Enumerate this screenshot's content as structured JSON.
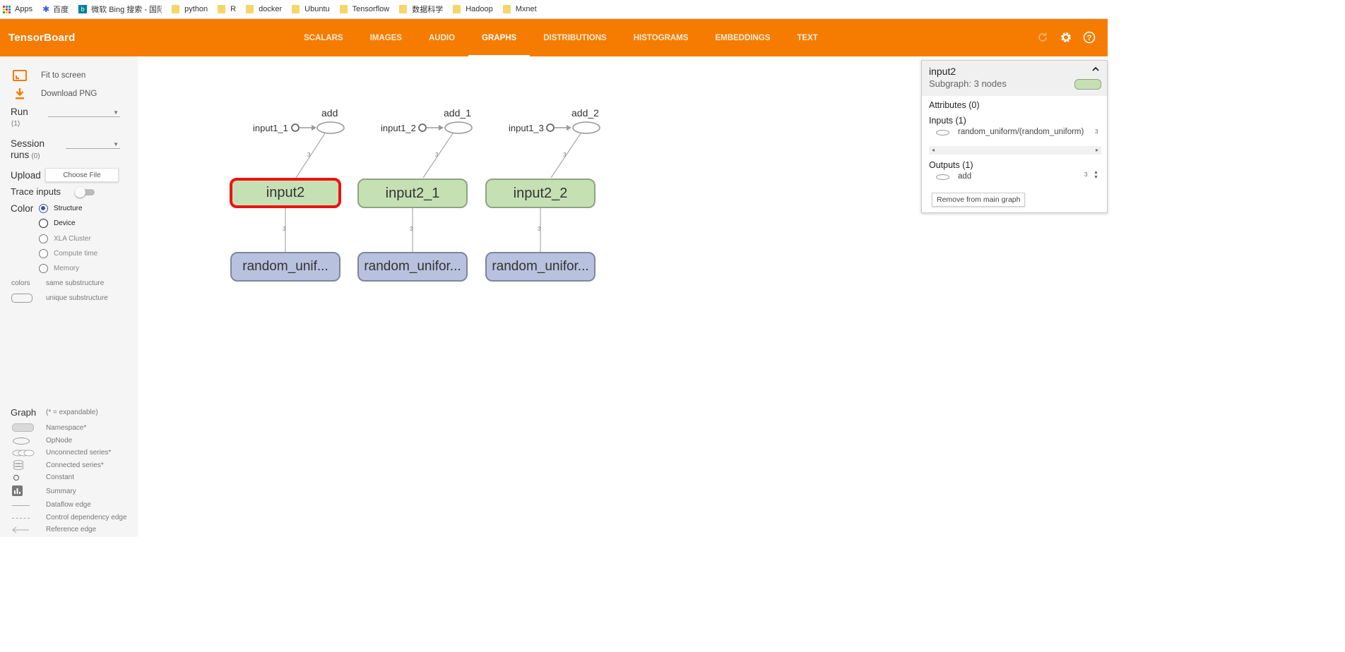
{
  "bookmarks": [
    {
      "label": "Apps",
      "icon": "apps-grid-icon"
    },
    {
      "label": "百度",
      "icon": "baidu-icon"
    },
    {
      "label": "微软 Bing 搜索 - 国际",
      "icon": "bing-icon"
    },
    {
      "label": "python",
      "icon": "folder-icon"
    },
    {
      "label": "R",
      "icon": "folder-icon"
    },
    {
      "label": "docker",
      "icon": "folder-icon"
    },
    {
      "label": "Ubuntu",
      "icon": "folder-icon"
    },
    {
      "label": "Tensorflow",
      "icon": "folder-icon"
    },
    {
      "label": "数据科学",
      "icon": "folder-icon"
    },
    {
      "label": "Hadoop",
      "icon": "folder-icon"
    },
    {
      "label": "Mxnet",
      "icon": "folder-icon"
    }
  ],
  "header": {
    "brand": "TensorBoard",
    "tabs": [
      "SCALARS",
      "IMAGES",
      "AUDIO",
      "GRAPHS",
      "DISTRIBUTIONS",
      "HISTOGRAMS",
      "EMBEDDINGS",
      "TEXT"
    ],
    "active_tab": "GRAPHS",
    "icons": [
      "refresh-icon",
      "settings-icon",
      "help-icon"
    ]
  },
  "sidebar": {
    "fit_to_screen": "Fit to screen",
    "download_png": "Download PNG",
    "run_label": "Run",
    "run_count": "(1)",
    "session_label_1": "Session",
    "session_label_2": "runs",
    "session_count": "(0)",
    "upload_label": "Upload",
    "choose_file": "Choose File",
    "trace_inputs": "Trace inputs",
    "color_label": "Color",
    "color_options": [
      "Structure",
      "Device",
      "XLA Cluster",
      "Compute time",
      "Memory"
    ],
    "color_selected": "Structure",
    "colors_label": "colors",
    "same_substructure": "same substructure",
    "unique_substructure": "unique substructure",
    "graph_label": "Graph",
    "expandable_note": "(* = expandable)",
    "legend": [
      "Namespace*",
      "OpNode",
      "Unconnected series*",
      "Connected series*",
      "Constant",
      "Summary",
      "Dataflow edge",
      "Control dependency edge",
      "Reference edge"
    ]
  },
  "graph": {
    "groups": [
      {
        "input_const": "input1_1",
        "op": "add",
        "namespace": "input2",
        "random": "random_unif...",
        "edge_label": "3",
        "selected": true
      },
      {
        "input_const": "input1_2",
        "op": "add_1",
        "namespace": "input2_1",
        "random": "random_unifor...",
        "edge_label": "3",
        "selected": false
      },
      {
        "input_const": "input1_3",
        "op": "add_2",
        "namespace": "input2_2",
        "random": "random_unifor...",
        "edge_label": "3",
        "selected": false
      }
    ],
    "colors": {
      "namespace_fill": "#c5e1b4",
      "random_fill": "#b8c2de",
      "selected_border": "#ee1111",
      "brand": "#f57c00"
    }
  },
  "info_card": {
    "title": "input2",
    "subtitle": "Subgraph: 3 nodes",
    "attributes": "Attributes (0)",
    "inputs": "Inputs (1)",
    "input_item": "random_uniform/(random_uniform)",
    "input_count": "3",
    "outputs": "Outputs (1)",
    "output_item": "add",
    "output_count": "3",
    "remove_button": "Remove from main graph"
  }
}
